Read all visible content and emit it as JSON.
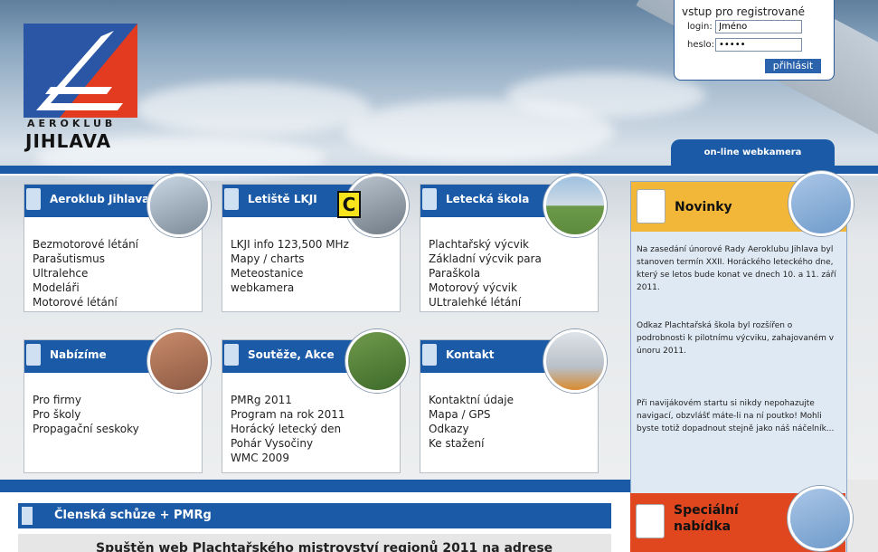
{
  "logo": {
    "line1": "AEROKLUB",
    "line2": "JIHLAVA"
  },
  "login": {
    "title": "vstup pro registrované",
    "login_label": "login:",
    "login_value": "Jméno",
    "password_label": "heslo:",
    "password_value": "•••••",
    "button": "přihlásit"
  },
  "webcam": {
    "label": "on-line webkamera"
  },
  "boxes": [
    {
      "title": "Aeroklub Jihlava",
      "items": [
        "Bezmotorové létání",
        "Parašutismus",
        "Ultralehce",
        "Modeláři",
        "Motorové létání"
      ]
    },
    {
      "title": "Letiště LKJI",
      "items": [
        "LKJI info 123,500 MHz",
        "Mapy / charts",
        "Meteostanice",
        "webkamera"
      ]
    },
    {
      "title": "Letecká škola",
      "items": [
        "Plachtařský výcvik",
        "Základní výcvik para",
        "Paraškola",
        "Motorový výcvik",
        "ULtralehké létání"
      ]
    },
    {
      "title": "Nabízíme",
      "items": [
        "Pro firmy",
        "Pro školy",
        "Propagační seskoky"
      ]
    },
    {
      "title": "Soutěže, Akce",
      "items": [
        "PMRg 2011",
        "Program na rok 2011",
        "Horácký letecký den",
        "Pohár Vysočiny",
        "WMC 2009"
      ]
    },
    {
      "title": "Kontakt",
      "items": [
        "Kontaktní údaje",
        "Mapa / GPS",
        "Odkazy",
        "Ke stažení"
      ]
    }
  ],
  "marker": "C",
  "news": {
    "title": "Novinky",
    "items": [
      "Na zasedání únorové Rady Aeroklubu Jihlava byl stanoven termín XXII. Horáckého leteckého dne, který se letos bude konat ve dnech 10. a 11. září 2011.",
      "Odkaz Plachtařská škola byl rozšířen o podrobnosti k pilotnímu výcviku, zahajovaném v únoru 2011.",
      "Při navijákovém startu si nikdy nepohazujte navigací, obzvlášť máte-li na ní poutko! Mohli byste totiž dopadnout stejně jako náš náčelník..."
    ]
  },
  "special": {
    "title_line1": "Speciální",
    "title_line2": "nabídka"
  },
  "bottom": {
    "bar_title": "Členská schůze + PMRg",
    "text": "Spuštěn web Plachtařského mistrovství regionů 2011 na adrese"
  },
  "colors": {
    "blue": "#1b5aa7",
    "news_header": "#f2b739",
    "special": "#e1471f",
    "news_bg": "#dfe9f4"
  }
}
